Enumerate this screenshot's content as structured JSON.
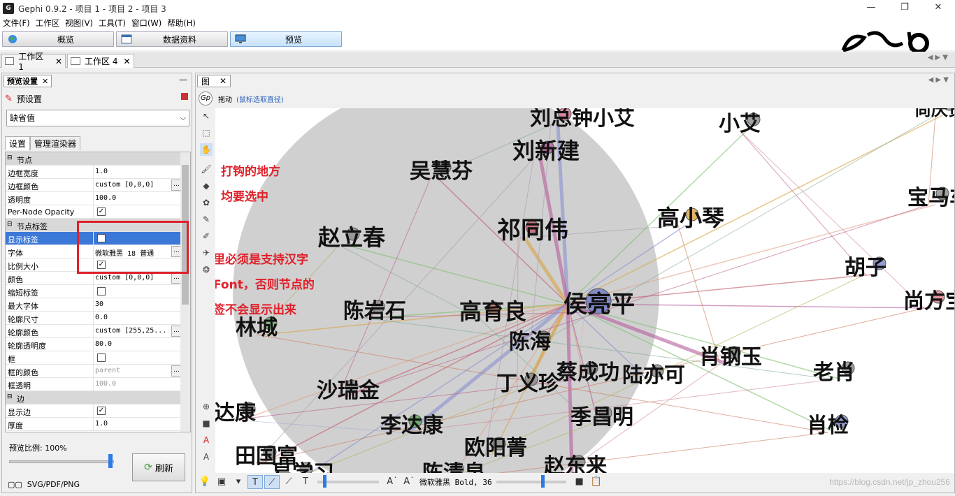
{
  "window": {
    "title": "Gephi 0.9.2 - 项目 1 - 项目 2 - 项目 3",
    "logo": "gephi-logo",
    "controls": [
      "—",
      "❐",
      "✕"
    ]
  },
  "menu": [
    "文件(F)",
    "工作区",
    "视图(V)",
    "工具(T)",
    "窗口(W)",
    "帮助(H)"
  ],
  "modes": [
    {
      "label": "概览",
      "icon": "globe-icon"
    },
    {
      "label": "数据资料",
      "icon": "table-icon"
    },
    {
      "label": "预览",
      "icon": "monitor-icon",
      "active": true
    }
  ],
  "workspaces": [
    {
      "label": "工作区 1",
      "close": "✕"
    },
    {
      "label": "工作区 4",
      "close": "✕",
      "active": true
    }
  ],
  "preview_panel": {
    "tab": "预览设置",
    "tab_close": "✕",
    "minimize": "—",
    "preset_label": "预设置",
    "preset_value": "缺省值",
    "tabs": [
      "设置",
      "管理渲染器"
    ],
    "ratio_label": "预览比例: 100%",
    "ratio_value": 1.0,
    "refresh": "刷新",
    "export": "SVG/PDF/PNG"
  },
  "properties": [
    {
      "type": "cat",
      "label": "节点"
    },
    {
      "label": "边框宽度",
      "value": "1.0"
    },
    {
      "label": "边框颜色",
      "value": "custom [0,0,0]",
      "dots": true
    },
    {
      "label": "透明度",
      "value": "100.0"
    },
    {
      "label": "Per-Node Opacity",
      "check": true
    },
    {
      "type": "cat",
      "label": "节点标签"
    },
    {
      "label": "显示标签",
      "check": true,
      "selected": true
    },
    {
      "label": "字体",
      "value": "微软雅黑 18 普通",
      "dots": true
    },
    {
      "label": "比例大小",
      "check": true
    },
    {
      "label": "颜色",
      "value": "custom [0,0,0]",
      "dots": true
    },
    {
      "label": "缩短标签",
      "check": false
    },
    {
      "label": "最大字体",
      "value": "30"
    },
    {
      "label": "轮廓尺寸",
      "value": "0.0"
    },
    {
      "label": "轮廓颜色",
      "value": "custom [255,25...",
      "dots": true
    },
    {
      "label": "轮廓透明度",
      "value": "80.0"
    },
    {
      "label": "框",
      "check": false
    },
    {
      "label": "框的颜色",
      "value": "parent",
      "dots": true,
      "disabled": true
    },
    {
      "label": "框透明",
      "value": "100.0",
      "disabled": true
    },
    {
      "type": "cat",
      "label": "边"
    },
    {
      "label": "显示边",
      "check": true
    },
    {
      "label": "厚度",
      "value": "1.0"
    }
  ],
  "graph_panel": {
    "tab": "图",
    "tab_close": "✕",
    "tool_hint": "拖动",
    "tool_hint2": "(鼠标选取直径)",
    "font_display": "微软雅黑 Bold, 36",
    "watermark": "https://blog.csdn.net/jp_zhou256"
  },
  "annotations": [
    "打钩的地方",
    "均要选中",
    "这里必须是支持汉字",
    "的Font，否则节点的",
    "标签不会显示出来"
  ],
  "graph_labels": [
    "刘总钟小艾",
    "小艾",
    "尚庆贺",
    "吴慧芬",
    "刘新建",
    "宝马车",
    "高小琴",
    "赵立春",
    "祁同伟",
    "胡子",
    "尚方宝剑",
    "高育良",
    "侯亮平",
    "陈岩石",
    "林城",
    "陈海",
    "肖钢玉",
    "蔡成功",
    "陆亦可",
    "老肖",
    "丁义珍",
    "沙瑞金",
    "季昌明",
    "达康",
    "李达康",
    "肖检",
    "欧阳菁",
    "田国富",
    "赵东来",
    "陈清泉",
    "易学习"
  ],
  "colors": {
    "accent": "#3c78d8",
    "annotation": "#e0202a",
    "highlight_circle": "#c8c8c8"
  }
}
